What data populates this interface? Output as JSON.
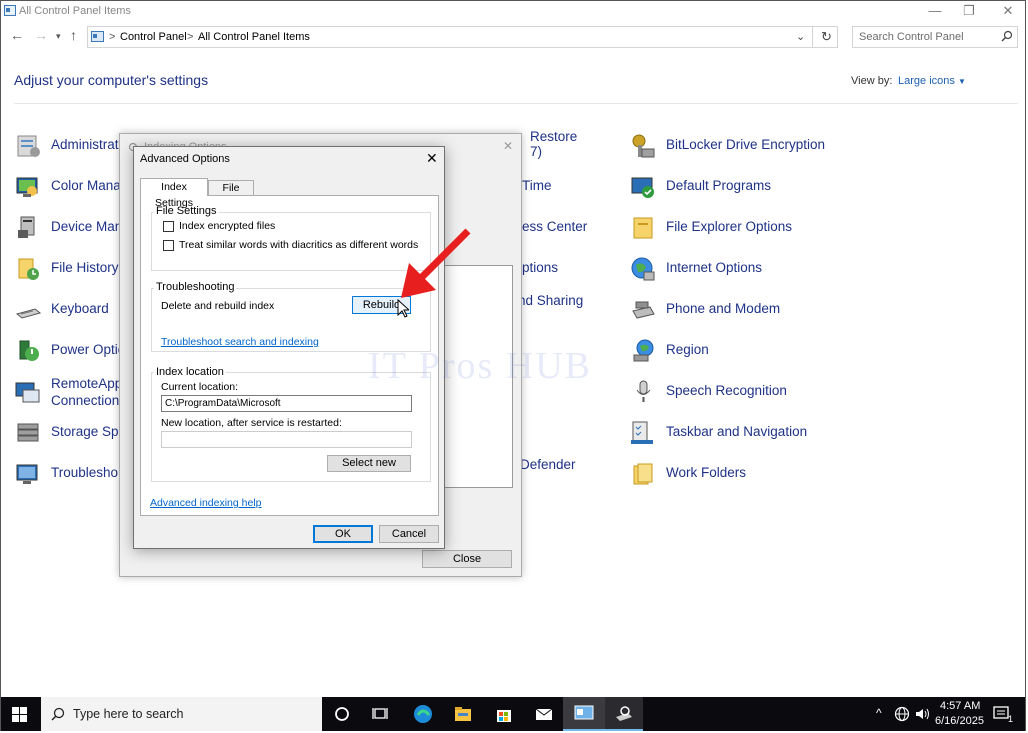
{
  "window": {
    "title": "All Control Panel Items",
    "minimize": "—",
    "restore": "❐",
    "close": "✕"
  },
  "addressbar": {
    "crumb1": "Control Panel",
    "crumb2": "All Control Panel Items",
    "sep": ">",
    "search_placeholder": "Search Control Panel"
  },
  "header": {
    "title": "Adjust your computer's settings",
    "view_by_label": "View by:",
    "view_by_value": "Large icons"
  },
  "items_left": [
    {
      "label": "Administrati"
    },
    {
      "label": "Color Mana"
    },
    {
      "label": "Device Mana"
    },
    {
      "label": "File History"
    },
    {
      "label": "Keyboard"
    },
    {
      "label": "Power Optic"
    },
    {
      "label": "RemoteApp",
      "label2": "Connections"
    },
    {
      "label": "Storage Spa"
    },
    {
      "label": "Troublesho"
    }
  ],
  "items_mid": [
    {
      "label": "Restore",
      "label2": "7)"
    },
    {
      "label": "Time"
    },
    {
      "label": "ess Center"
    },
    {
      "label": "ptions"
    },
    {
      "label": "nd Sharing"
    },
    {
      "label": "Defender"
    }
  ],
  "items_right": [
    {
      "label": "BitLocker Drive Encryption"
    },
    {
      "label": "Default Programs"
    },
    {
      "label": "File Explorer Options"
    },
    {
      "label": "Internet Options"
    },
    {
      "label": "Phone and Modem"
    },
    {
      "label": "Region"
    },
    {
      "label": "Speech Recognition"
    },
    {
      "label": "Taskbar and Navigation"
    },
    {
      "label": "Work Folders"
    }
  ],
  "indexing_window": {
    "title": "Indexing Options",
    "close_label": "Close",
    "close_x": "✕"
  },
  "advanced": {
    "title": "Advanced Options",
    "close_x": "✕",
    "tabs": [
      "Index Settings",
      "File Types"
    ],
    "file_settings": {
      "title": "File Settings",
      "cb1": "Index encrypted files",
      "cb2": "Treat similar words with diacritics as different words"
    },
    "troubleshooting": {
      "title": "Troubleshooting",
      "label": "Delete and rebuild index",
      "rebuild": "Rebuild",
      "link": "Troubleshoot search and indexing"
    },
    "index_location": {
      "title": "Index location",
      "current_label": "Current location:",
      "current_value": "C:\\ProgramData\\Microsoft",
      "new_label": "New location, after service is restarted:",
      "new_value": "",
      "select_new": "Select new"
    },
    "help_link": "Advanced indexing help",
    "ok": "OK",
    "cancel": "Cancel"
  },
  "watermark": "IT Pros HUB",
  "taskbar": {
    "search_placeholder": "Type here to search",
    "time": "4:57 AM",
    "date": "6/16/2025",
    "notif_count": "1"
  },
  "colors": {
    "link_blue": "#1e3287",
    "accent_blue": "#0078d7",
    "arrow_red": "#e81f1f"
  }
}
